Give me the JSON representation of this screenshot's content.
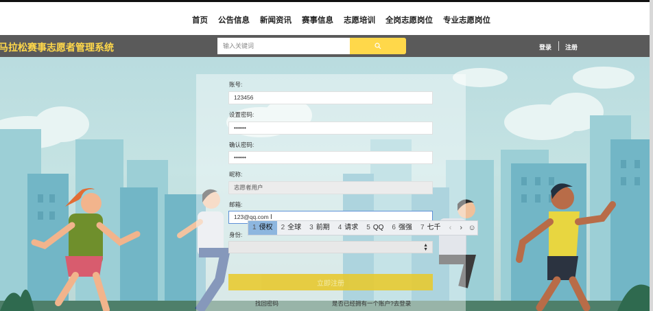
{
  "nav": {
    "items": [
      "首页",
      "公告信息",
      "新闻资讯",
      "赛事信息",
      "志愿培训",
      "全岗志愿岗位",
      "专业志愿岗位"
    ]
  },
  "header": {
    "brand": "马拉松赛事志愿者管理系统",
    "search_placeholder": "输入关键词",
    "login": "登录",
    "register": "注册"
  },
  "form": {
    "account_label": "账号:",
    "account_value": "123456",
    "password_label": "设置密码:",
    "password_value": "••••••",
    "confirm_label": "确认密码:",
    "confirm_value": "••••••",
    "nickname_label": "昵称:",
    "nickname_value": "志愿者用户",
    "email_label": "邮箱:",
    "email_value": "123@qq.com",
    "identity_label": "身份:",
    "submit": "立即注册",
    "forgot": "找回密码",
    "have_account": "是否已经拥有一个账户?去登录"
  },
  "ime": {
    "candidates": [
      {
        "num": "1",
        "text": "侵权"
      },
      {
        "num": "2",
        "text": "全球"
      },
      {
        "num": "3",
        "text": "前期"
      },
      {
        "num": "4",
        "text": "请求"
      },
      {
        "num": "5",
        "text": "QQ"
      },
      {
        "num": "6",
        "text": "强强"
      },
      {
        "num": "7",
        "text": "七千"
      }
    ],
    "prev": "‹",
    "next": "›",
    "emoji": "☺"
  },
  "colors": {
    "accent": "#ffd84a",
    "header_bg": "#5a5a5a",
    "sky": "#b9dcdf"
  }
}
